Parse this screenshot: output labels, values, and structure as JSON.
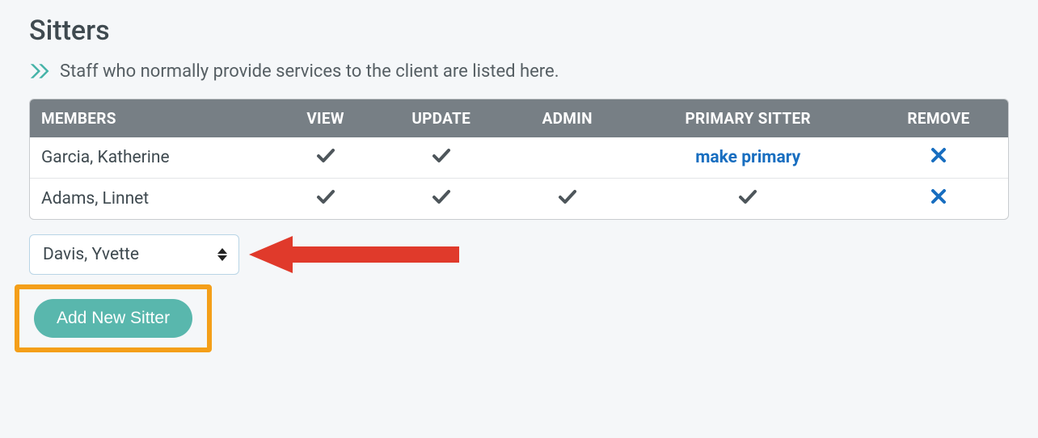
{
  "title": "Sitters",
  "subtitle": "Staff who normally provide services to the client are listed here.",
  "table": {
    "headers": {
      "members": "MEMBERS",
      "view": "VIEW",
      "update": "UPDATE",
      "admin": "ADMIN",
      "primary": "PRIMARY SITTER",
      "remove": "REMOVE"
    },
    "rows": [
      {
        "name": "Garcia, Katherine",
        "view": true,
        "update": true,
        "admin": false,
        "primary_check": false,
        "primary_label": "make primary",
        "remove": true
      },
      {
        "name": "Adams, Linnet",
        "view": true,
        "update": true,
        "admin": true,
        "primary_check": true,
        "primary_label": "",
        "remove": true
      }
    ]
  },
  "select": {
    "value": "Davis, Yvette"
  },
  "add_button": {
    "label": "Add New Sitter"
  }
}
